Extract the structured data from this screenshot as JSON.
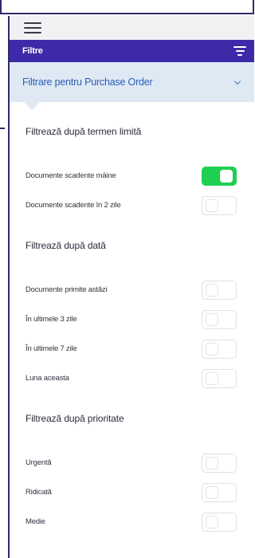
{
  "header": {
    "title": "Filtre"
  },
  "section": {
    "label": "Filtrare pentru Purchase Order"
  },
  "groups": [
    {
      "title": "Filtrează după termen limită",
      "items": [
        {
          "label": "Documente scadente mâine",
          "on": true
        },
        {
          "label": "Documente scadente în 2 zile",
          "on": false
        }
      ]
    },
    {
      "title": "Filtrează după dată",
      "items": [
        {
          "label": "Documente primite astăzi",
          "on": false
        },
        {
          "label": "În ultimele 3 zile",
          "on": false
        },
        {
          "label": "În ultimele 7 zile",
          "on": false
        },
        {
          "label": "Luna aceasta",
          "on": false
        }
      ]
    },
    {
      "title": "Filtrează după prioritate",
      "items": [
        {
          "label": "Urgentă",
          "on": false
        },
        {
          "label": "Ridicată",
          "on": false
        },
        {
          "label": "Medie",
          "on": false
        }
      ]
    }
  ],
  "colors": {
    "brand": "#3d2aa8",
    "toggle_on": "#1fcf52",
    "section_bg": "#dfe9f4",
    "section_text": "#2b5db5"
  }
}
